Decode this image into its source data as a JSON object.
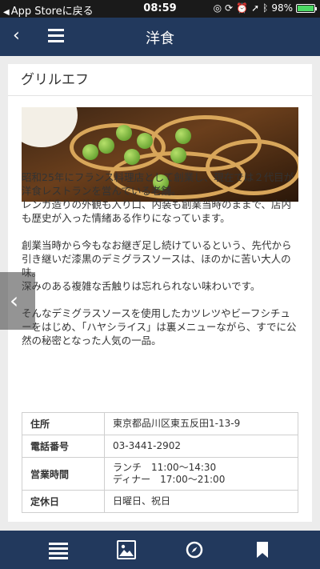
{
  "status_bar": {
    "back_app": "App Storeに戻る",
    "time": "08:59",
    "battery": "98%",
    "battery_level": 0.98
  },
  "nav": {
    "title": "洋食",
    "icons": [
      "back-icon",
      "hamburger-menu-icon"
    ]
  },
  "restaurant": {
    "name": "グリルエフ",
    "description": [
      "昭和25年にフランス料理店として創業し、現在では２代目が洋食レストランを営んでいる老舗。\nレンガ造りの外観も入り口、内装も創業当時のままで、店内も歴史が入った情緒ある作りになっています。",
      "創業当時から今もなお継ぎ足し続けているという、先代から引き継いだ漆黒のデミグラスソースは、ほのかに苦い大人の味。\n深みのある複雑な舌触りは忘れられない味わいです。",
      "そんなデミグラスソースを使用したカツレツやビーフシチューをはじめ、「ハヤシライス」は裏メニューながら、すでに公然の秘密となった人気の一品。"
    ],
    "info": [
      {
        "label": "住所",
        "value": "東京都品川区東五反田1-13-9"
      },
      {
        "label": "電話番号",
        "value": "03-3441-2902"
      },
      {
        "label": "営業時間",
        "value": "ランチ　11:00〜14:30\nディナー　17:00〜21:00"
      },
      {
        "label": "定休日",
        "value": "日曜日、祝日"
      }
    ]
  },
  "side_nav": {
    "prev_glyph": "‹"
  },
  "tab_bar": {
    "icons": [
      "list-icon",
      "image-icon",
      "compass-icon",
      "bookmark-icon"
    ]
  },
  "colors": {
    "nav_bg": "#22395d",
    "status_bg": "#1a1a1a",
    "page_bg": "#ececec",
    "battery_fill": "#4cd964"
  }
}
